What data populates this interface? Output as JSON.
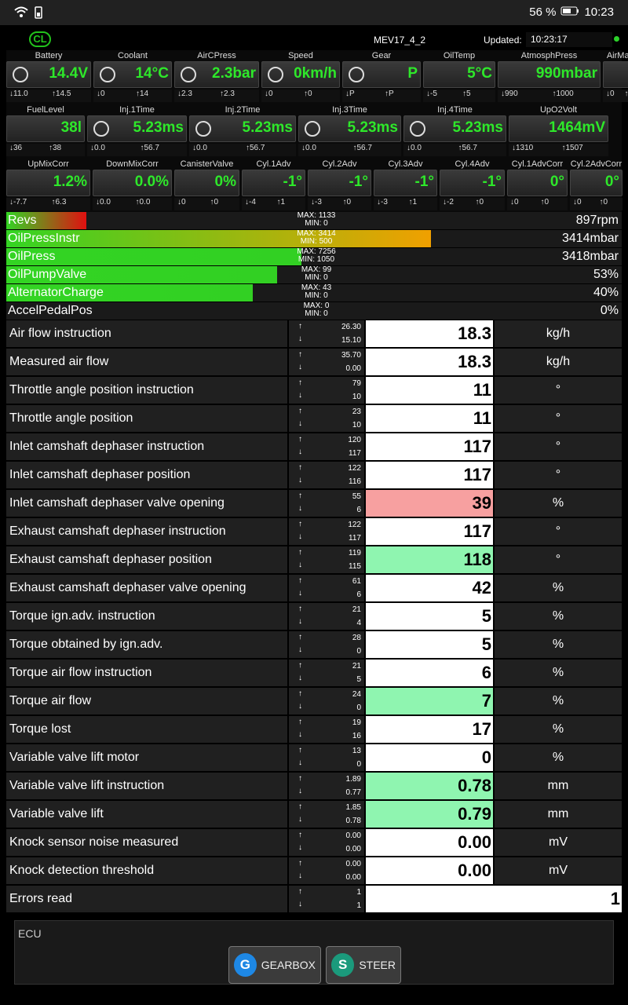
{
  "status": {
    "battery_pct": "56 %",
    "time": "10:23"
  },
  "app": {
    "cl_badge": "CL",
    "ecu_name": "MEV17_4_2",
    "updated_label": "Updated:",
    "updated_time": "10:23:17"
  },
  "gauges_row1": [
    {
      "label": "Battery",
      "value": "14.4V",
      "min": "11.0",
      "max": "14.5",
      "icon": "battery-icon"
    },
    {
      "label": "Coolant",
      "value": "14°C",
      "min": "0",
      "max": "14",
      "icon": "coolant-icon"
    },
    {
      "label": "AirCPress",
      "value": "2.3bar",
      "min": "2.3",
      "max": "2.3",
      "icon": "snowflake-icon"
    },
    {
      "label": "Speed",
      "value": "0km/h",
      "min": "0",
      "max": "0",
      "icon": "speedometer-icon"
    },
    {
      "label": "Gear",
      "value": "P",
      "min": "P",
      "max": "P",
      "icon": "gear-shift-icon"
    },
    {
      "label": "OilTemp",
      "value": "5°C",
      "min": "-5",
      "max": "5",
      "icon": ""
    },
    {
      "label": "AtmosphPress",
      "value": "990mbar",
      "min": "990",
      "max": "1000",
      "icon": ""
    },
    {
      "label": "AirMani",
      "value": "0",
      "min": "0",
      "max": "",
      "icon": ""
    }
  ],
  "gauges_row2": [
    {
      "label": "FuelLevel",
      "value": "38l",
      "min": "36",
      "max": "38",
      "icon": ""
    },
    {
      "label": "Inj.1Time",
      "value": "5.23ms",
      "min": "0.0",
      "max": "56.7",
      "icon": "injector-icon"
    },
    {
      "label": "Inj.2Time",
      "value": "5.23ms",
      "min": "0.0",
      "max": "56.7",
      "icon": "injector-icon"
    },
    {
      "label": "Inj.3Time",
      "value": "5.23ms",
      "min": "0.0",
      "max": "56.7",
      "icon": "injector-icon"
    },
    {
      "label": "Inj.4Time",
      "value": "5.23ms",
      "min": "0.0",
      "max": "56.7",
      "icon": "injector-icon"
    },
    {
      "label": "UpO2Volt",
      "value": "1464mV",
      "min": "1310",
      "max": "1507",
      "icon": ""
    }
  ],
  "gauges_row3": [
    {
      "label": "UpMixCorr",
      "value": "1.2%",
      "min": "-7.7",
      "max": "6.3"
    },
    {
      "label": "DownMixCorr",
      "value": "0.0%",
      "min": "0.0",
      "max": "0.0"
    },
    {
      "label": "CanisterValve",
      "value": "0%",
      "min": "0",
      "max": "0"
    },
    {
      "label": "Cyl.1Adv",
      "value": "-1°",
      "min": "-4",
      "max": "1"
    },
    {
      "label": "Cyl.2Adv",
      "value": "-1°",
      "min": "-3",
      "max": "0"
    },
    {
      "label": "Cyl.3Adv",
      "value": "-1°",
      "min": "-3",
      "max": "1"
    },
    {
      "label": "Cyl.4Adv",
      "value": "-1°",
      "min": "-2",
      "max": "0"
    },
    {
      "label": "Cyl.1AdvCorr",
      "value": "0°",
      "min": "0",
      "max": "0"
    },
    {
      "label": "Cyl.2AdvCorr",
      "value": "0°",
      "min": "0",
      "max": "0"
    }
  ],
  "bars": [
    {
      "name": "Revs",
      "max": "MAX: 1133",
      "min": "MIN: 0",
      "value": "897rpm",
      "fill": 0.13,
      "color": "#e01010"
    },
    {
      "name": "OilPressInstr",
      "max": "MAX: 3414",
      "min": "MIN: 500",
      "value": "3414mbar",
      "fill": 0.69,
      "color": "#f0a000"
    },
    {
      "name": "OilPress",
      "max": "MAX: 7256",
      "min": "MIN: 1050",
      "value": "3418mbar",
      "fill": 0.48,
      "color": "#32d023"
    },
    {
      "name": "OilPumpValve",
      "max": "MAX: 99",
      "min": "MIN: 0",
      "value": "53%",
      "fill": 0.44,
      "color": "#32d023"
    },
    {
      "name": "AlternatorCharge",
      "max": "MAX: 43",
      "min": "MIN: 0",
      "value": "40%",
      "fill": 0.4,
      "color": "#32d023"
    },
    {
      "name": "AccelPedalPos",
      "max": "MAX: 0",
      "min": "MIN: 0",
      "value": "0%",
      "fill": 0,
      "color": "#32d023"
    }
  ],
  "rows": [
    {
      "label": "Air flow instruction",
      "max": "26.30",
      "min": "15.10",
      "value": "18.3",
      "unit": "kg/h",
      "bg": "#ffffff"
    },
    {
      "label": "Measured air flow",
      "max": "35.70",
      "min": "0.00",
      "value": "18.3",
      "unit": "kg/h",
      "bg": "#ffffff"
    },
    {
      "label": "Throttle angle position instruction",
      "max": "79",
      "min": "10",
      "value": "11",
      "unit": "°",
      "bg": "#ffffff"
    },
    {
      "label": "Throttle angle position",
      "max": "23",
      "min": "10",
      "value": "11",
      "unit": "°",
      "bg": "#ffffff"
    },
    {
      "label": "Inlet camshaft dephaser instruction",
      "max": "120",
      "min": "117",
      "value": "117",
      "unit": "°",
      "bg": "#ffffff"
    },
    {
      "label": "Inlet camshaft dephaser position",
      "max": "122",
      "min": "116",
      "value": "117",
      "unit": "°",
      "bg": "#ffffff"
    },
    {
      "label": "Inlet camshaft dephaser valve opening",
      "max": "55",
      "min": "6",
      "value": "39",
      "unit": "%",
      "bg": "#f7a0a0"
    },
    {
      "label": "Exhaust camshaft dephaser instruction",
      "max": "122",
      "min": "117",
      "value": "117",
      "unit": "°",
      "bg": "#ffffff"
    },
    {
      "label": "Exhaust camshaft dephaser position",
      "max": "119",
      "min": "115",
      "value": "118",
      "unit": "°",
      "bg": "#8ff5b0"
    },
    {
      "label": "Exhaust camshaft dephaser valve opening",
      "max": "61",
      "min": "6",
      "value": "42",
      "unit": "%",
      "bg": "#ffffff"
    },
    {
      "label": "Torque ign.adv. instruction",
      "max": "21",
      "min": "4",
      "value": "5",
      "unit": "%",
      "bg": "#ffffff"
    },
    {
      "label": "Torque obtained by ign.adv.",
      "max": "28",
      "min": "0",
      "value": "5",
      "unit": "%",
      "bg": "#ffffff"
    },
    {
      "label": "Torque air flow instruction",
      "max": "21",
      "min": "5",
      "value": "6",
      "unit": "%",
      "bg": "#ffffff"
    },
    {
      "label": "Torque air flow",
      "max": "24",
      "min": "0",
      "value": "7",
      "unit": "%",
      "bg": "#8ff5b0"
    },
    {
      "label": "Torque lost",
      "max": "19",
      "min": "16",
      "value": "17",
      "unit": "%",
      "bg": "#ffffff"
    },
    {
      "label": "Variable valve lift motor",
      "max": "13",
      "min": "0",
      "value": "0",
      "unit": "%",
      "bg": "#ffffff"
    },
    {
      "label": "Variable valve lift instruction",
      "max": "1.89",
      "min": "0.77",
      "value": "0.78",
      "unit": "mm",
      "bg": "#8ff5b0"
    },
    {
      "label": "Variable valve lift",
      "max": "1.85",
      "min": "0.78",
      "value": "0.79",
      "unit": "mm",
      "bg": "#8ff5b0"
    },
    {
      "label": "Knock sensor noise measured",
      "max": "0.00",
      "min": "0.00",
      "value": "0.00",
      "unit": "mV",
      "bg": "#ffffff"
    },
    {
      "label": "Knock detection threshold",
      "max": "0.00",
      "min": "0.00",
      "value": "0.00",
      "unit": "mV",
      "bg": "#ffffff"
    },
    {
      "label": "Errors read",
      "max": "1",
      "min": "1",
      "value": "1",
      "unit": "",
      "bg": "#ffffff"
    }
  ],
  "bottom": {
    "caption": "ECU",
    "buttons": [
      {
        "letter": "G",
        "label": "GEARBOX",
        "color": "#1e88e5"
      },
      {
        "letter": "S",
        "label": "STEER",
        "color": "#1b9a7c"
      }
    ]
  }
}
